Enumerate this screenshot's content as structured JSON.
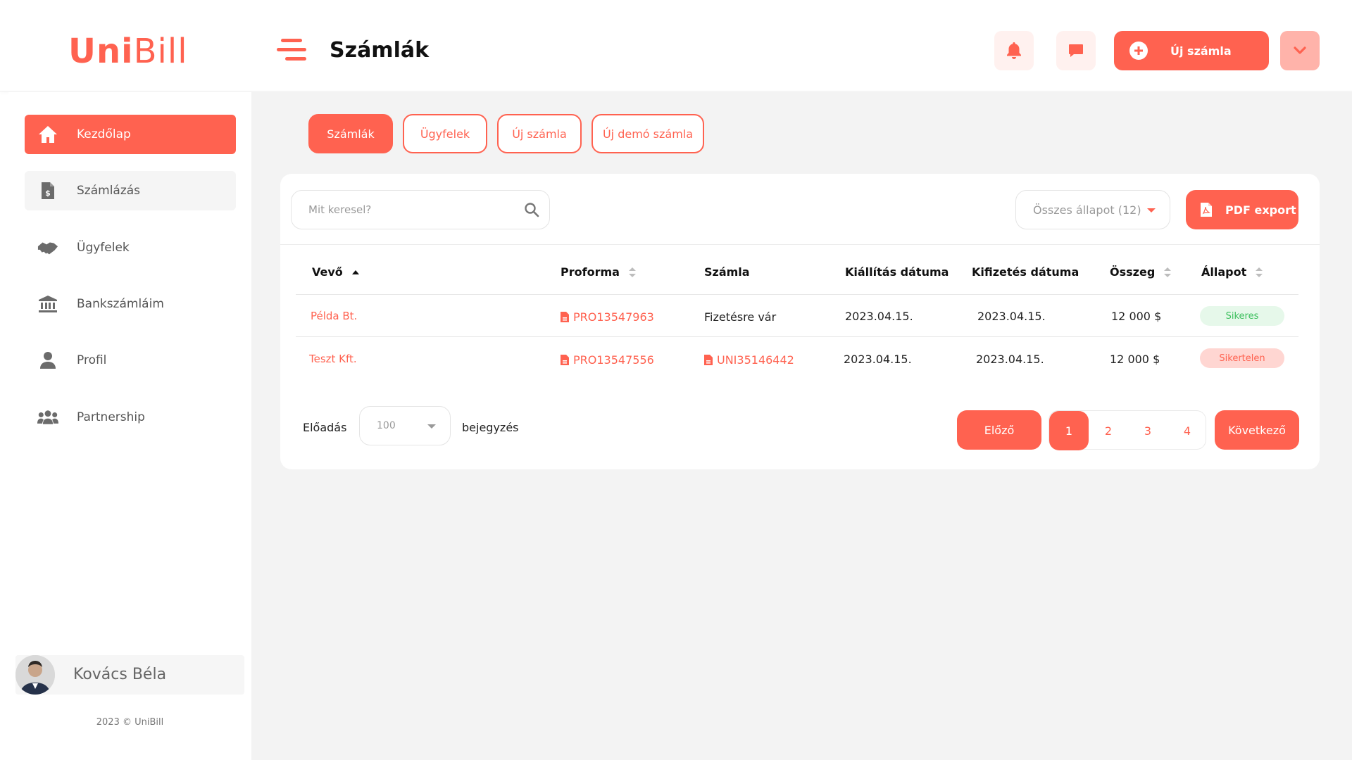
{
  "brand": {
    "logo_bold": "Uni",
    "logo_light": "Bill",
    "color": "#ff6250"
  },
  "header": {
    "title": "Számlák",
    "new_invoice_label": "Új számla",
    "icons": [
      "menu-icon",
      "bell-icon",
      "chat-icon",
      "plus-circle-icon",
      "chevron-down-icon"
    ]
  },
  "sidebar": {
    "items": [
      {
        "label": "Kezdőlap",
        "icon": "home-icon",
        "active": true
      },
      {
        "label": "Számlázás",
        "icon": "invoice-dollar-icon",
        "active": false
      },
      {
        "label": "Ügyfelek",
        "icon": "handshake-icon",
        "active": false
      },
      {
        "label": "Bankszámláim",
        "icon": "bank-icon",
        "active": false
      },
      {
        "label": "Profil",
        "icon": "user-icon",
        "active": false
      },
      {
        "label": "Partnership",
        "icon": "users-icon",
        "active": false
      }
    ],
    "user_name": "Kovács Béla",
    "copyright": "2023 © UniBill"
  },
  "tabs": [
    {
      "label": "Számlák",
      "active": true
    },
    {
      "label": "Ügyfelek",
      "active": false
    },
    {
      "label": "Új számla",
      "active": false
    },
    {
      "label": "Új demó számla",
      "active": false
    }
  ],
  "toolbar": {
    "search_placeholder": "Mit keresel?",
    "status_filter": "Összes állapot (12)",
    "pdf_export_label": "PDF export"
  },
  "table": {
    "columns": [
      "Vevő",
      "Proforma",
      "Számla",
      "Kiállítás dátuma",
      "Kifizetés dátuma",
      "Összeg",
      "Állapot"
    ],
    "rows": [
      {
        "customer": "Példa Bt.",
        "proforma": "PRO13547963",
        "invoice": "Fizetésre vár",
        "issue_date": "2023.04.15.",
        "payment_date": "2023.04.15.",
        "amount": "12 000 $",
        "status": "Sikeres"
      },
      {
        "customer": "Teszt Kft.",
        "proforma": "PRO13547556",
        "invoice": "UNI35146442",
        "issue_date": "2023.04.15.",
        "payment_date": "2023.04.15.",
        "amount": "12 000 $",
        "status": "Sikertelen"
      }
    ]
  },
  "footer": {
    "show_label": "Előadás",
    "page_length": "100",
    "entries_label": "bejegyzés",
    "prev_label": "Előző",
    "next_label": "Következő",
    "pages": [
      "1",
      "2",
      "3",
      "4"
    ]
  },
  "colors": {
    "accent": "#ff6250",
    "success_bg": "#e6f8ea",
    "success_text": "#3bbf5c",
    "fail_bg": "#ffd6d2"
  }
}
